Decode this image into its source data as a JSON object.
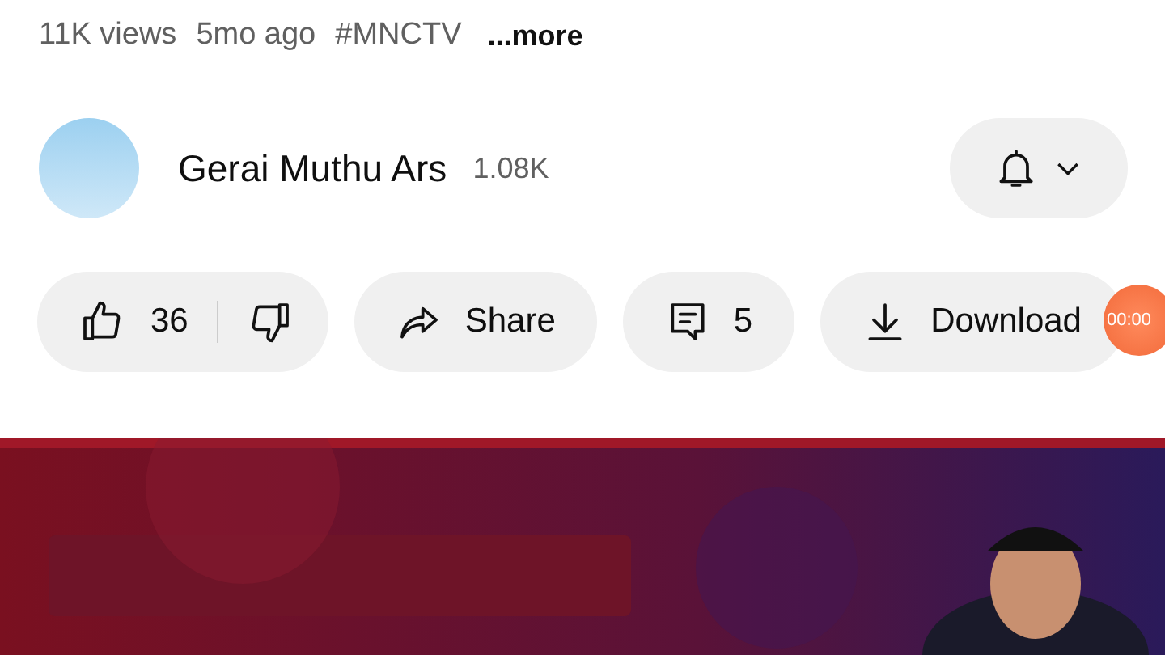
{
  "meta": {
    "views": "11K views",
    "age": "5mo ago",
    "hashtag": "#MNCTV",
    "more": "...more"
  },
  "channel": {
    "name": "Gerai Muthu Ars",
    "subscribers": "1.08K"
  },
  "actions": [
    {
      "kind": "like",
      "likes": "36"
    },
    {
      "kind": "share",
      "label": "Share"
    },
    {
      "kind": "comments",
      "label": "5"
    },
    {
      "kind": "download",
      "label": "Download"
    }
  ],
  "recorder": {
    "time": "00:00"
  }
}
